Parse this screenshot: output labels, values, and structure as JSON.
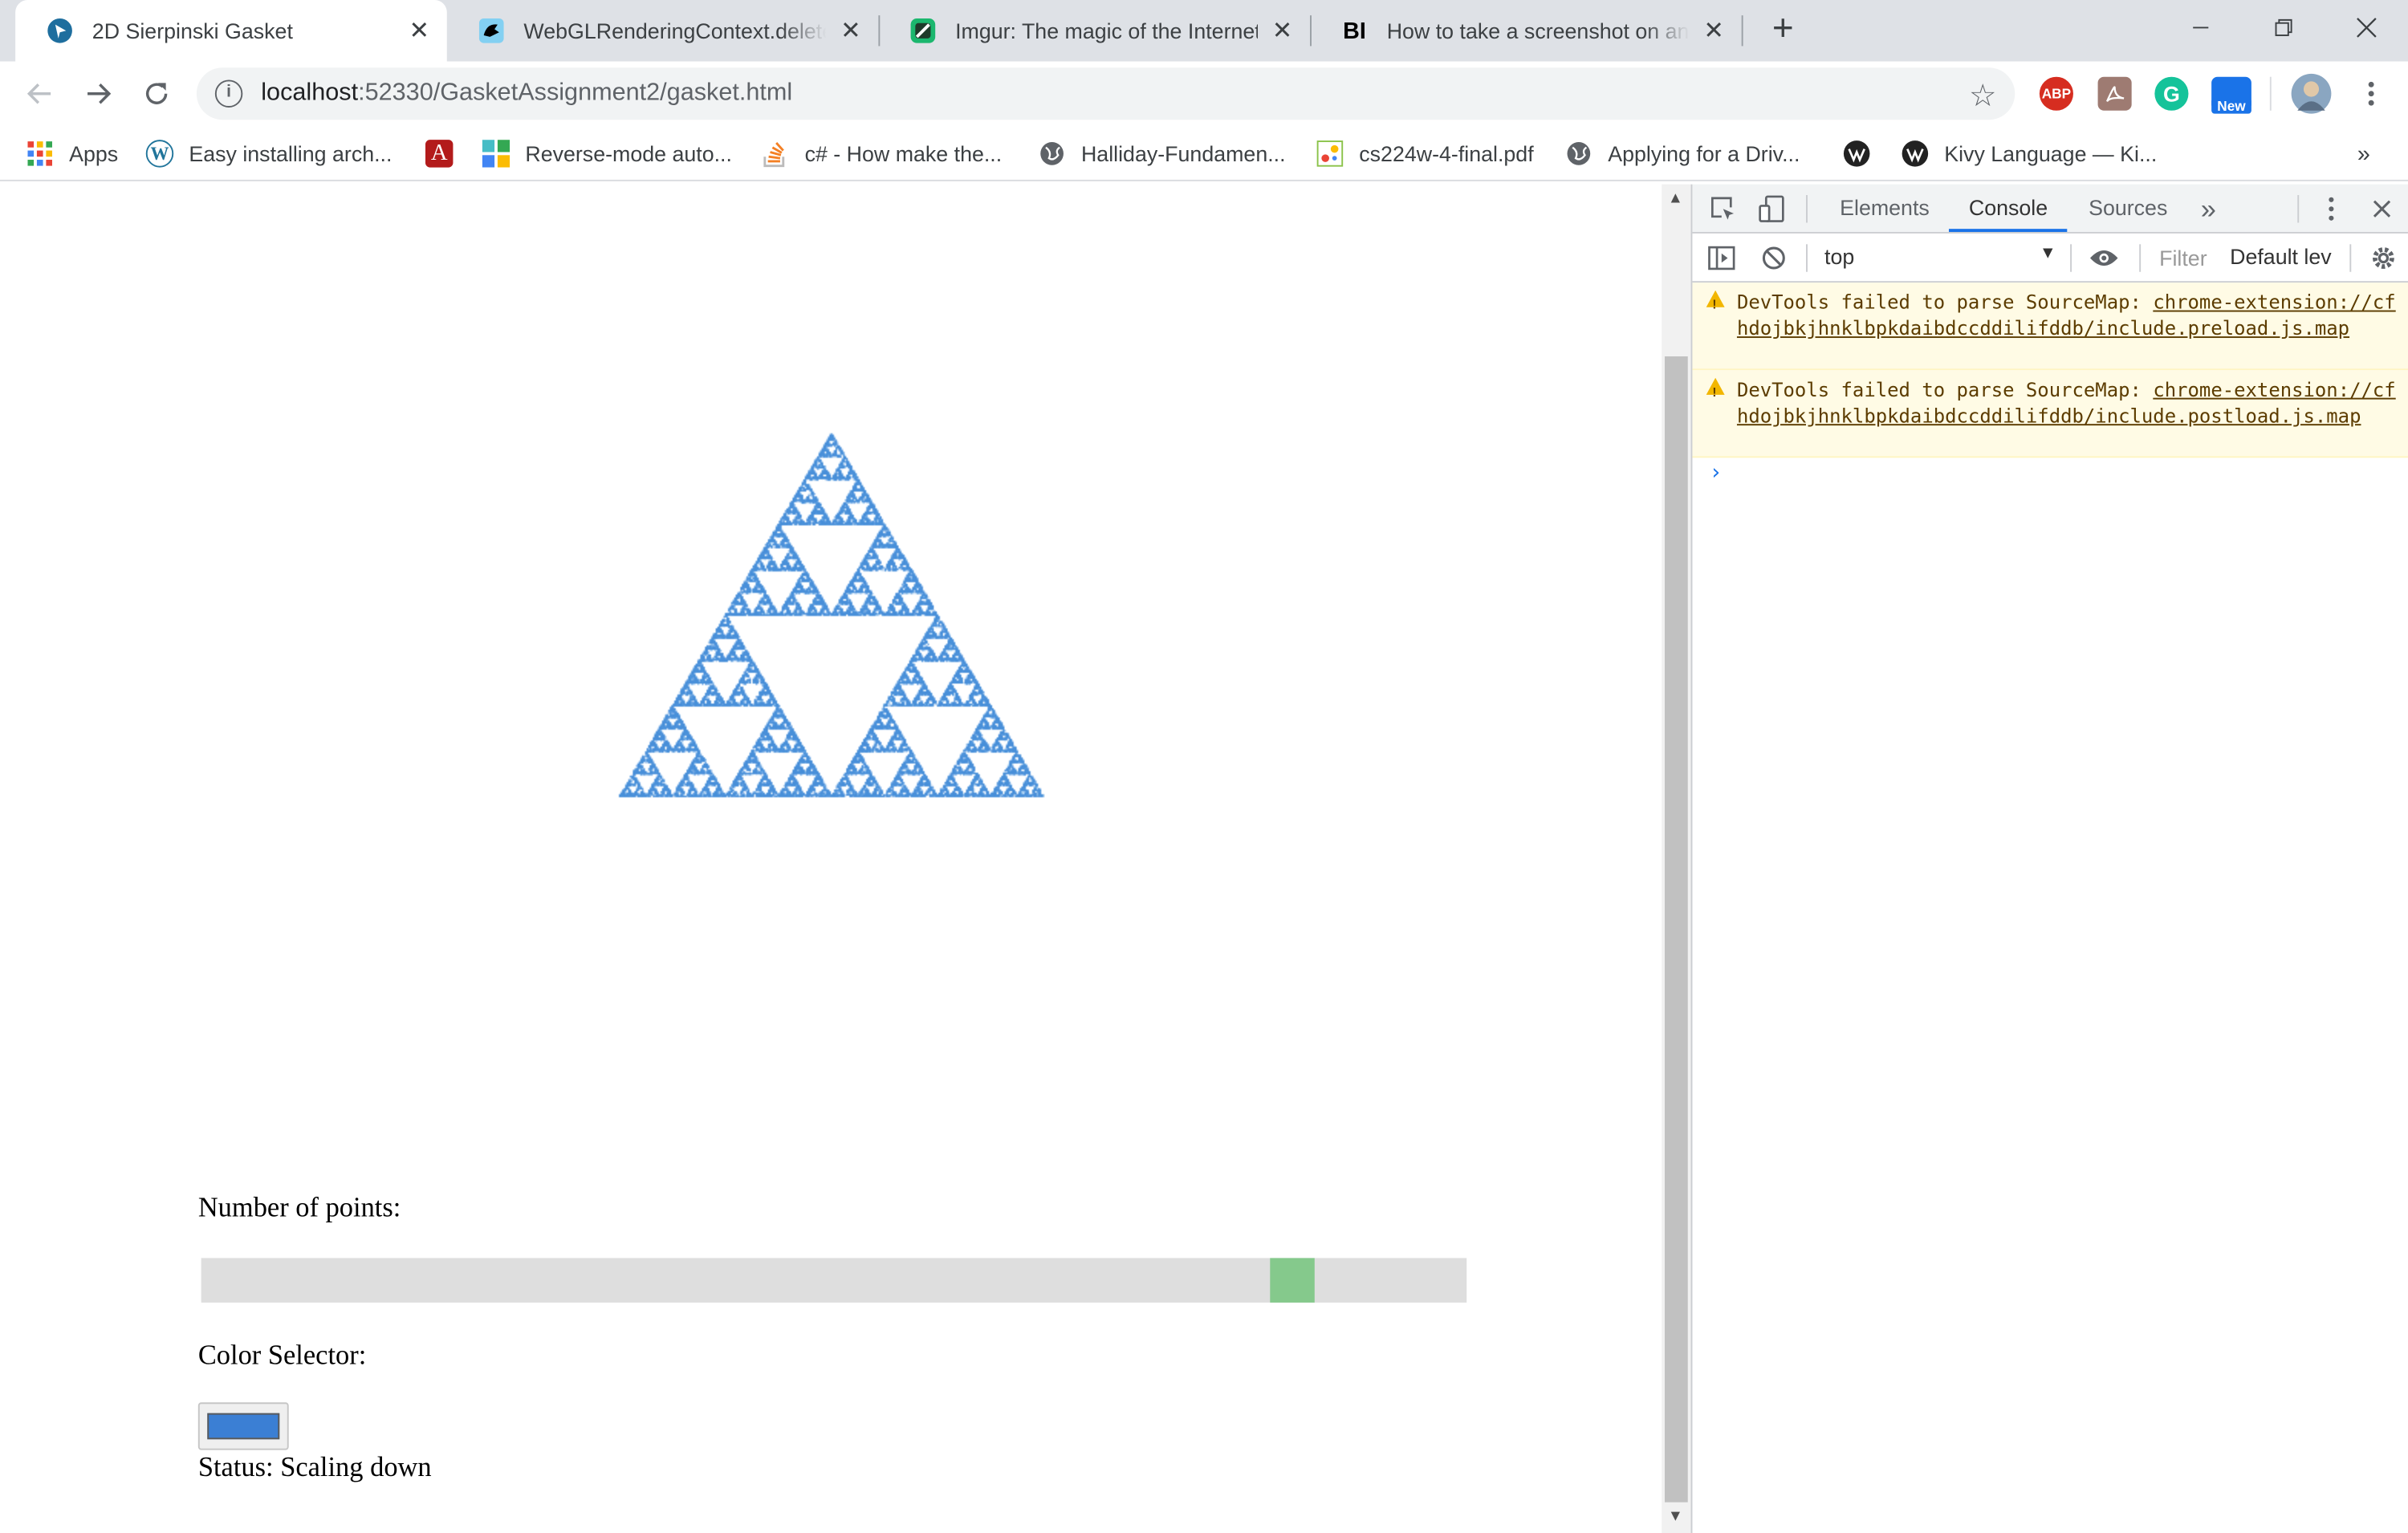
{
  "tabs": [
    {
      "title": "2D Sierpinski Gasket",
      "active": true
    },
    {
      "title": "WebGLRenderingContext.deleteB",
      "active": false
    },
    {
      "title": "Imgur: The magic of the Internet",
      "active": false
    },
    {
      "title": "How to take a screenshot on any",
      "active": false
    }
  ],
  "tab_icons": {
    "tab4": "BI"
  },
  "toolbar": {
    "url_host": "localhost",
    "url_rest": ":52330/GasketAssignment2/gasket.html",
    "ext_abp": "ABP",
    "ext_new": "New"
  },
  "bookmarks": [
    {
      "label": "Apps"
    },
    {
      "label": "Easy installing arch..."
    },
    {
      "label": "Reverse-mode auto..."
    },
    {
      "label": "c# - How make the..."
    },
    {
      "label": "Halliday-Fundamen..."
    },
    {
      "label": "cs224w-4-final.pdf"
    },
    {
      "label": "Applying for a Driv..."
    },
    {
      "label": "Kivy Language — Ki..."
    }
  ],
  "page": {
    "points_label": "Number of points:",
    "color_label": "Color Selector:",
    "status_text": "Status: Scaling down",
    "points_slider_fraction": 0.875,
    "selected_color": "#3b7fd4",
    "gasket_color": "#4a90d9"
  },
  "devtools": {
    "tabs": [
      "Elements",
      "Console",
      "Sources"
    ],
    "active_tab": "Console",
    "context": "top",
    "filter_placeholder": "Filter",
    "level": "Default lev",
    "messages": [
      {
        "prefix": "DevTools failed to parse SourceMap: ",
        "link": "chrome-extension://cfhdojbkjhnklbpkdaibdccddilifddb/include.preload.js.map"
      },
      {
        "prefix": "DevTools failed to parse SourceMap: ",
        "link": "chrome-extension://cfhdojbkjhnklbpkdaibdccddilifddb/include.postload.js.map"
      }
    ]
  }
}
